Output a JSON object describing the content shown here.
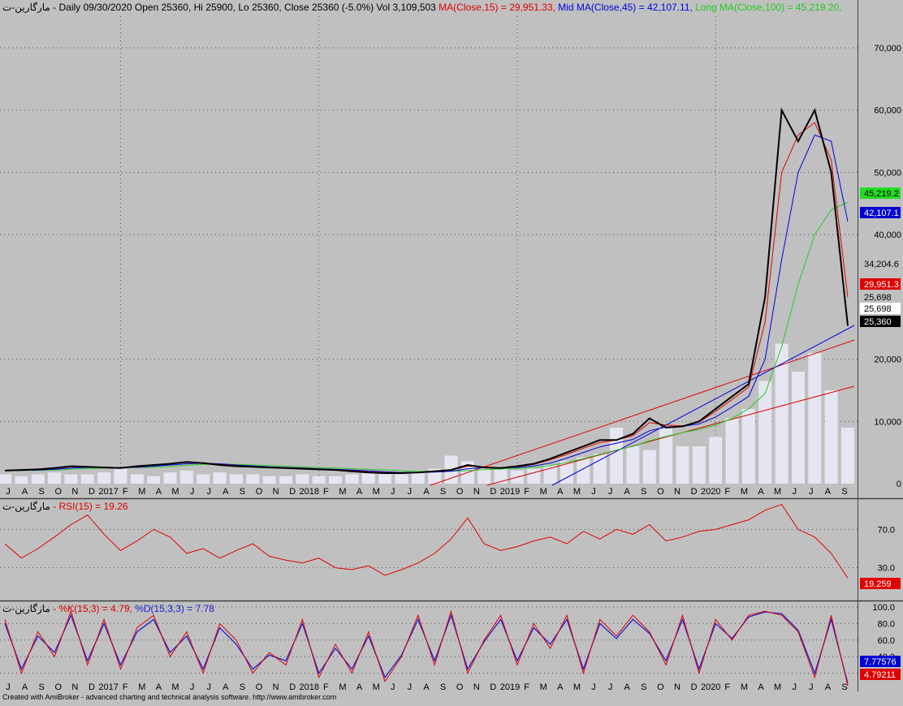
{
  "header": {
    "symbol": "مارگارین-ت",
    "info": "- Daily 09/30/2020 Open 25360, Hi 25900, Lo 25360, Close 25360 (-5.0%) Vol 3,109,503",
    "ma15": "MA(Close,15) = 29,951.33,",
    "ma45": "Mid MA(Close,45) = 42,107.11,",
    "ma100": "Long MA(Close,100) = 45,219.20,"
  },
  "rsi_header": {
    "symbol": "مارگارین-ت",
    "label": "- RSI(15) = 19.26"
  },
  "stoch_header": {
    "symbol": "مارگارین-ت",
    "k": "- %K(15,3) = 4.79,",
    "d": "%D(15,3,3) = 7.78"
  },
  "price_badges": {
    "long_ma": "45,219.2",
    "mid_ma": "42,107.1",
    "level_a": "34,204.6",
    "ma15": "29,951.3",
    "level_b": "25,698",
    "level_c": "25,698",
    "close": "25,360"
  },
  "rsi_badge": "19.259",
  "stoch_badges": {
    "d": "7.77576",
    "k": "4.79211"
  },
  "footer": "Created with AmiBroker - advanced charting and technical analysis software. http://www.amibroker.com",
  "colors": {
    "background": "#c0c0c0",
    "volume": "#e6e6f2",
    "ma15": "#e00000",
    "ma45": "#0000e0",
    "ma100": "#22cc22",
    "rsi": "#e00000",
    "stoch_k": "#e00000",
    "stoch_d": "#2020d0",
    "trend_red": "#e00000",
    "trend_blue": "#0000e0"
  },
  "chart_data": [
    {
      "type": "line",
      "title": "مارگارین-ت - Daily",
      "y_ticks": [
        "70,000",
        "60,000",
        "50,000",
        "40,000",
        "20,000",
        "10,000",
        "0"
      ],
      "ylim": [
        0,
        73000
      ],
      "x_ticks": [
        "J",
        "A",
        "S",
        "O",
        "N",
        "D",
        "2017",
        "F",
        "M",
        "A",
        "M",
        "J",
        "J",
        "A",
        "S",
        "O",
        "N",
        "D",
        "2018",
        "F",
        "M",
        "A",
        "M",
        "J",
        "J",
        "A",
        "S",
        "O",
        "N",
        "D",
        "2019",
        "F",
        "M",
        "A",
        "M",
        "J",
        "J",
        "A",
        "S",
        "O",
        "N",
        "D",
        "2020",
        "F",
        "M",
        "A",
        "M",
        "J",
        "J",
        "A",
        "S"
      ],
      "x": [
        "2016-06",
        "2016-07",
        "2016-08",
        "2016-09",
        "2016-10",
        "2016-11",
        "2016-12",
        "2017-01",
        "2017-02",
        "2017-03",
        "2017-04",
        "2017-05",
        "2017-06",
        "2017-07",
        "2017-08",
        "2017-09",
        "2017-10",
        "2017-11",
        "2017-12",
        "2018-01",
        "2018-02",
        "2018-03",
        "2018-04",
        "2018-05",
        "2018-06",
        "2018-07",
        "2018-08",
        "2018-09",
        "2018-10",
        "2018-11",
        "2018-12",
        "2019-01",
        "2019-02",
        "2019-03",
        "2019-04",
        "2019-05",
        "2019-06",
        "2019-07",
        "2019-08",
        "2019-09",
        "2019-10",
        "2019-11",
        "2019-12",
        "2020-01",
        "2020-02",
        "2020-03",
        "2020-04",
        "2020-05",
        "2020-06",
        "2020-07",
        "2020-08",
        "2020-09"
      ],
      "series": [
        {
          "name": "Close",
          "values": [
            2100,
            2200,
            2300,
            2500,
            2800,
            2700,
            2600,
            2500,
            2800,
            3000,
            3200,
            3500,
            3300,
            3000,
            2800,
            2700,
            2600,
            2500,
            2400,
            2300,
            2200,
            2000,
            1800,
            1700,
            1700,
            1800,
            2000,
            2200,
            3000,
            2600,
            2500,
            2800,
            3200,
            4000,
            5000,
            6000,
            7000,
            7000,
            8000,
            10500,
            9000,
            9200,
            10000,
            12000,
            14000,
            16000,
            30000,
            60000,
            55000,
            60000,
            50000,
            25360
          ]
        },
        {
          "name": "MA(Close,15)",
          "values": [
            2100,
            2150,
            2250,
            2450,
            2700,
            2720,
            2650,
            2550,
            2700,
            2950,
            3150,
            3400,
            3350,
            3100,
            2900,
            2750,
            2650,
            2550,
            2450,
            2350,
            2250,
            2100,
            1900,
            1780,
            1720,
            1780,
            1950,
            2150,
            2800,
            2700,
            2550,
            2700,
            3100,
            3800,
            4700,
            5700,
            6600,
            7000,
            7700,
            9800,
            9400,
            9300,
            9900,
            11600,
            13500,
            15500,
            26000,
            50000,
            56000,
            58000,
            52000,
            29951
          ]
        },
        {
          "name": "Mid MA(Close,45)",
          "values": [
            2100,
            2120,
            2180,
            2300,
            2500,
            2620,
            2640,
            2600,
            2620,
            2800,
            3000,
            3200,
            3300,
            3200,
            3000,
            2850,
            2700,
            2600,
            2500,
            2400,
            2300,
            2200,
            2050,
            1900,
            1800,
            1780,
            1850,
            2000,
            2400,
            2550,
            2550,
            2600,
            2850,
            3300,
            4100,
            5000,
            5900,
            6500,
            7100,
            8500,
            9100,
            9200,
            9600,
            10700,
            12300,
            14000,
            20000,
            36000,
            50000,
            56000,
            55000,
            42107
          ]
        },
        {
          "name": "Long MA(Close,100)",
          "values": [
            2100,
            2110,
            2140,
            2200,
            2330,
            2450,
            2520,
            2550,
            2570,
            2650,
            2780,
            2950,
            3100,
            3150,
            3100,
            3000,
            2900,
            2800,
            2700,
            2600,
            2500,
            2400,
            2300,
            2200,
            2080,
            1980,
            1950,
            1980,
            2100,
            2250,
            2350,
            2450,
            2600,
            2900,
            3400,
            4000,
            4700,
            5400,
            6000,
            6900,
            7600,
            8200,
            8700,
            9400,
            10500,
            12000,
            14500,
            22000,
            32000,
            40000,
            44000,
            45219
          ]
        },
        {
          "name": "Vol",
          "values": [
            0.05,
            0.04,
            0.05,
            0.06,
            0.05,
            0.05,
            0.06,
            0.08,
            0.05,
            0.04,
            0.06,
            0.07,
            0.05,
            0.06,
            0.05,
            0.05,
            0.04,
            0.04,
            0.05,
            0.04,
            0.04,
            0.05,
            0.06,
            0.05,
            0.05,
            0.07,
            0.08,
            0.15,
            0.12,
            0.09,
            0.08,
            0.07,
            0.08,
            0.1,
            0.12,
            0.14,
            0.16,
            0.3,
            0.2,
            0.18,
            0.3,
            0.2,
            0.2,
            0.25,
            0.35,
            0.4,
            0.55,
            0.75,
            0.6,
            0.7,
            0.5,
            0.3
          ]
        }
      ]
    },
    {
      "type": "line",
      "title": "RSI(15)",
      "y_ticks": [
        "70.0",
        "30.0"
      ],
      "ylim": [
        0,
        100
      ],
      "series": [
        {
          "name": "RSI(15)",
          "values": [
            55,
            40,
            50,
            62,
            75,
            85,
            65,
            48,
            58,
            70,
            62,
            45,
            50,
            40,
            48,
            55,
            42,
            38,
            35,
            40,
            30,
            28,
            32,
            22,
            28,
            35,
            45,
            60,
            82,
            55,
            48,
            52,
            58,
            62,
            55,
            68,
            60,
            70,
            65,
            75,
            58,
            62,
            68,
            70,
            75,
            80,
            90,
            96,
            70,
            62,
            45,
            19.26
          ]
        }
      ]
    },
    {
      "type": "line",
      "title": "Stochastic",
      "y_ticks": [
        "100.0",
        "80.0",
        "60.0",
        "40.0",
        "20.0"
      ],
      "ylim": [
        0,
        100
      ],
      "series": [
        {
          "name": "%K(15,3)",
          "values": [
            85,
            20,
            70,
            40,
            95,
            30,
            85,
            25,
            75,
            90,
            40,
            70,
            20,
            80,
            60,
            20,
            45,
            30,
            85,
            15,
            55,
            20,
            70,
            10,
            40,
            90,
            30,
            95,
            20,
            60,
            90,
            30,
            80,
            50,
            90,
            20,
            85,
            65,
            90,
            70,
            30,
            90,
            20,
            85,
            60,
            90,
            95,
            90,
            70,
            15,
            90,
            4.79
          ]
        },
        {
          "name": "%D(15,3,3)",
          "values": [
            80,
            25,
            65,
            45,
            90,
            35,
            80,
            30,
            70,
            85,
            45,
            65,
            25,
            75,
            55,
            25,
            42,
            35,
            80,
            20,
            50,
            25,
            65,
            15,
            42,
            85,
            35,
            90,
            25,
            58,
            85,
            35,
            75,
            55,
            85,
            25,
            80,
            62,
            85,
            68,
            35,
            85,
            25,
            80,
            62,
            88,
            94,
            92,
            72,
            20,
            85,
            7.78
          ]
        }
      ]
    }
  ]
}
